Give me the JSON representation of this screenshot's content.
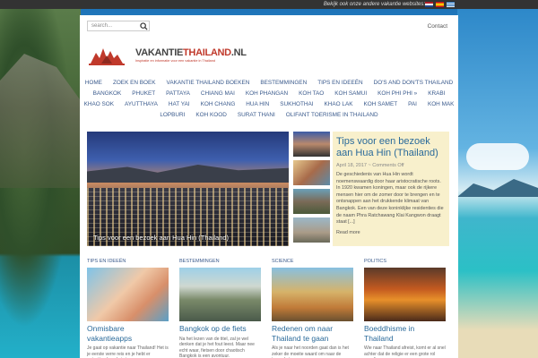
{
  "topbar": {
    "text": "Bekijk ook onze andere vakantie websites:",
    "flags": [
      "netherlands-flag-icon",
      "spain-flag-icon",
      "greece-flag-icon"
    ]
  },
  "search": {
    "placeholder": "search..."
  },
  "header": {
    "contact_label": "Contact",
    "logo_text_main": "VAKANTIE",
    "logo_text_brand": "THAILAND",
    "logo_text_tld": ".NL",
    "logo_subtitle": "Inspiratie en informatie voor een vakantie in Thailand"
  },
  "nav": {
    "rows": [
      [
        "HOME",
        "ZOEK EN BOEK",
        "VAKANTIE THAILAND BOEKEN",
        "BESTEMMINGEN",
        "TIPS EN IDEEËN",
        "DO'S AND DON'TS THAILAND"
      ],
      [
        "BANGKOK",
        "PHUKET",
        "PATTAYA",
        "CHIANG MAI",
        "KOH PHANGAN",
        "KOH TAO",
        "KOH SAMUI",
        "KOH PHI PHI »",
        "KRABI"
      ],
      [
        "KHAO SOK",
        "AYUTTHAYA",
        "HAT YAI",
        "KOH CHANG",
        "HUA HIN",
        "SUKHOTHAI",
        "KHAO LAK",
        "KOH SAMET",
        "PAI",
        "KOH MAK"
      ],
      [
        "LOPBURI",
        "KOH KOOD",
        "SURAT THANI",
        "OLIFANT TOERISME IN THAILAND"
      ]
    ]
  },
  "featured": {
    "caption": "Tips voor een bezoek aan Hua Hin (Thailand)",
    "title": "Tips voor een bezoek aan Hua Hin (Thailand)",
    "date": "April 18, 2017",
    "comments": "Comments Off",
    "excerpt": "De geschiedenis van Hua Hin wordt noemenswaardig door haar aristocratische roots. In 1920 kwamen koningen, maar ook de rijkere mensen hier om de zomer door te brengen en te ontsnappen aan het drukkende klimaat van Bangkok. Een van deze koninklijke residenties die de naam Phra Ratchawang Klai Kangwon draagt staat [...]",
    "read_more": "Read more"
  },
  "columns": [
    {
      "label": "TIPS EN IDEEËN",
      "title": "Onmisbare vakantieapps",
      "text": "Je gaat op vakantie naar Thailand! Het is je eerste verre reis en je hebt er ontzettend veel zin in."
    },
    {
      "label": "BESTEMMINGEN",
      "title": "Bangkok op de fiets",
      "text": "Na het lezen van de titel, zal je wel denken dat je het fout leest. Maar nee echt waar, fietsen door chaotisch Bangkok is een avontuur."
    },
    {
      "label": "SCIENCE",
      "title": "Redenen om naar Thailand te gaan",
      "text": "Als je naar het noorden gaat dan is het zeker de moeite waard om naar de tempels te gaan."
    },
    {
      "label": "POLITICS",
      "title": "Boeddhisme in Thailand",
      "text": "Wie naar Thailand afreist, komt er al snel achter dat de religie er een grote rol speelt."
    }
  ]
}
